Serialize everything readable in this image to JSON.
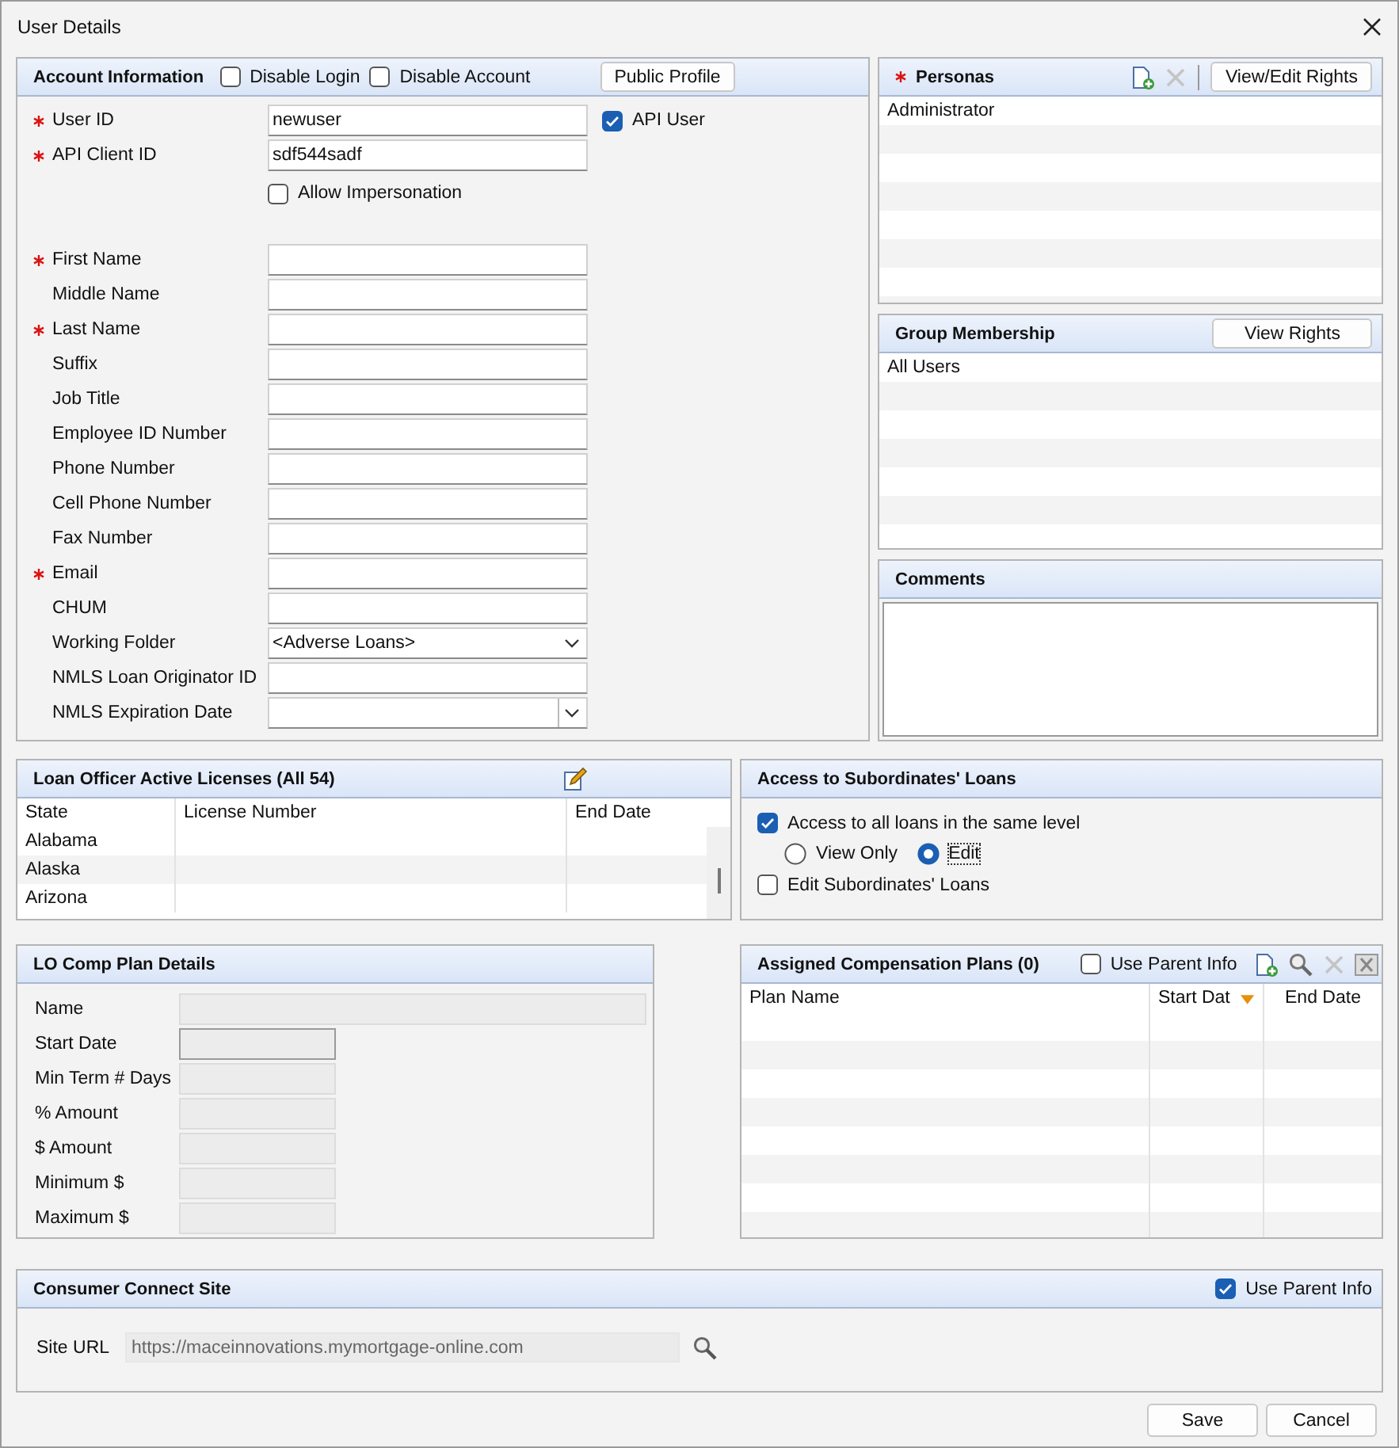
{
  "window": {
    "title": "User Details"
  },
  "account_information": {
    "title": "Account Information",
    "options": [
      {
        "label": "Disable Login",
        "checked": false
      },
      {
        "label": "Disable Account",
        "checked": false
      }
    ],
    "public_profile_button": "Public Profile",
    "api_user": {
      "label": "API User",
      "checked": true
    },
    "allow_impersonation": {
      "label": "Allow Impersonation",
      "checked": false
    },
    "id_fields": [
      {
        "label": "User ID",
        "required": true,
        "value": "newuser"
      },
      {
        "label": "API Client ID",
        "required": true,
        "value": "sdf544sadf"
      }
    ],
    "fields": [
      {
        "label": "First Name",
        "required": true,
        "kind": "text"
      },
      {
        "label": "Middle Name",
        "required": false,
        "kind": "text"
      },
      {
        "label": "Last Name",
        "required": true,
        "kind": "text"
      },
      {
        "label": "Suffix",
        "required": false,
        "kind": "text"
      },
      {
        "label": "Job Title",
        "required": false,
        "kind": "text"
      },
      {
        "label": "Employee ID Number",
        "required": false,
        "kind": "text"
      },
      {
        "label": "Phone Number",
        "required": false,
        "kind": "text"
      },
      {
        "label": "Cell Phone Number",
        "required": false,
        "kind": "text"
      },
      {
        "label": "Fax Number",
        "required": false,
        "kind": "text"
      },
      {
        "label": "Email",
        "required": true,
        "kind": "text"
      },
      {
        "label": "CHUM",
        "required": false,
        "kind": "text"
      },
      {
        "label": "Working Folder",
        "required": false,
        "kind": "dropdown",
        "value": "<Adverse Loans>"
      },
      {
        "label": "NMLS Loan Originator ID",
        "required": false,
        "kind": "text"
      },
      {
        "label": "NMLS Expiration Date",
        "required": false,
        "kind": "date"
      }
    ]
  },
  "personas": {
    "title": "Personas",
    "required": true,
    "tools": [
      {
        "kind": "add",
        "disabled": false
      },
      {
        "kind": "delete",
        "disabled": true
      }
    ],
    "button": "View/Edit Rights",
    "items": [
      "Administrator"
    ]
  },
  "group_membership": {
    "title": "Group Membership",
    "button": "View Rights",
    "items": [
      "All Users"
    ]
  },
  "comments": {
    "title": "Comments"
  },
  "licenses": {
    "title": "Loan Officer Active Licenses (All 54)",
    "columns": [
      "State",
      "License Number",
      "End Date"
    ],
    "rows": [
      {
        "state": "Alabama"
      },
      {
        "state": "Alaska"
      },
      {
        "state": "Arizona"
      }
    ]
  },
  "subordinates": {
    "title": "Access to Subordinates' Loans",
    "access_all": {
      "label": "Access to all loans in the same level",
      "checked": true
    },
    "modes": [
      {
        "label": "View Only",
        "selected": false
      },
      {
        "label": "Edit",
        "selected": true
      }
    ],
    "edit_subordinates": {
      "label": "Edit Subordinates' Loans",
      "checked": false
    }
  },
  "lo_comp_plan": {
    "title": "LO Comp Plan Details",
    "fields": [
      "Name",
      "Start Date",
      "Min Term # Days",
      "% Amount",
      "$ Amount",
      "Minimum $",
      "Maximum $"
    ]
  },
  "compensation_plans": {
    "title": "Assigned Compensation Plans (0)",
    "use_parent_info": {
      "label": "Use Parent Info",
      "checked": false
    },
    "tools": [
      {
        "kind": "add",
        "disabled": false
      },
      {
        "kind": "find",
        "disabled": false
      },
      {
        "kind": "delete",
        "disabled": true
      },
      {
        "kind": "export",
        "disabled": true
      }
    ],
    "columns": [
      {
        "label": "Plan Name",
        "sorted": false
      },
      {
        "label": "Start Dat",
        "sorted": true
      },
      {
        "label": "End Date",
        "sorted": false
      }
    ]
  },
  "consumer_connect": {
    "title": "Consumer Connect Site",
    "use_parent_info": {
      "label": "Use Parent Info",
      "checked": true
    },
    "site_url_label": "Site URL",
    "site_url": "https://maceinnovations.mymortgage-online.com"
  },
  "buttons": [
    "Save",
    "Cancel"
  ]
}
